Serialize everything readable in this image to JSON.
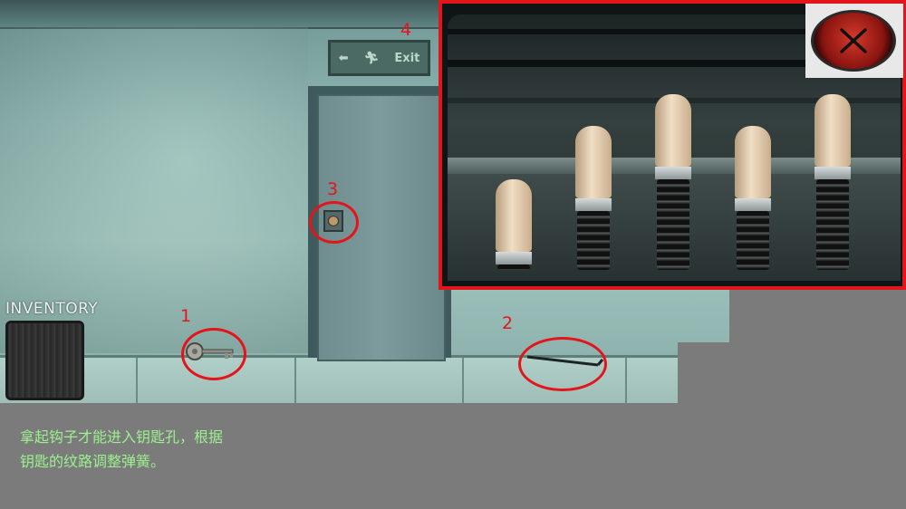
{
  "inventory": {
    "label": "INVENTORY"
  },
  "exit_sign": {
    "text": "Exit"
  },
  "markers": [
    "1",
    "2",
    "3",
    "4"
  ],
  "lock_pins": [
    {
      "position": 1,
      "spring_level": 0.05
    },
    {
      "position": 2,
      "spring_level": 0.55
    },
    {
      "position": 3,
      "spring_level": 0.85
    },
    {
      "position": 4,
      "spring_level": 0.55
    },
    {
      "position": 5,
      "spring_level": 0.85
    }
  ],
  "close_button": {
    "icon": "close-x-icon"
  },
  "hint": {
    "line1": "拿起钩子才能进入钥匙孔，根据",
    "line2": "钥匙的纹路调整弹簧。"
  },
  "colors": {
    "highlight": "#e4141b",
    "hint_text": "#9cf08f",
    "background": "#7b7b7b"
  }
}
